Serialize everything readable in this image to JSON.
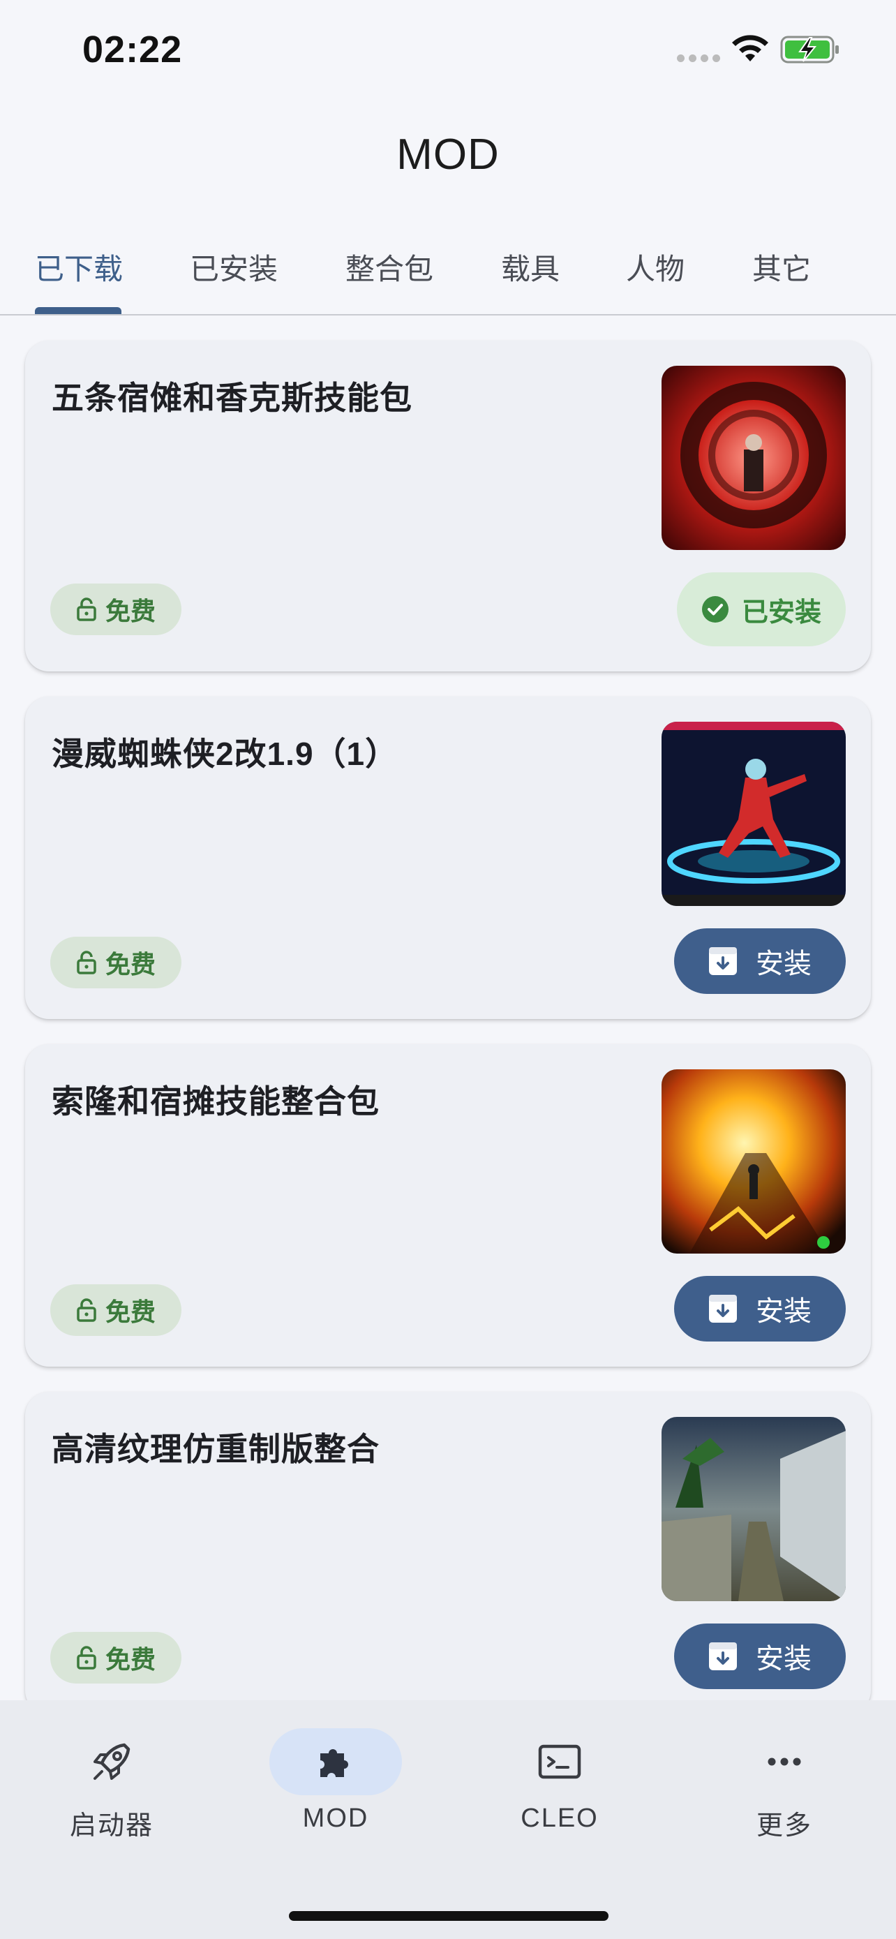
{
  "status_bar": {
    "time": "02:22"
  },
  "header": {
    "title": "MOD"
  },
  "tabs": [
    {
      "label": "已下载",
      "active": true
    },
    {
      "label": "已安装",
      "active": false
    },
    {
      "label": "整合包",
      "active": false
    },
    {
      "label": "载具",
      "active": false
    },
    {
      "label": "人物",
      "active": false
    },
    {
      "label": "其它",
      "active": false
    }
  ],
  "mods": [
    {
      "title": "五条宿傩和香克斯技能包",
      "price_label": "免费",
      "action_label": "已安装",
      "installed": true,
      "thumbnail": "red-ring-scene"
    },
    {
      "title": "漫威蜘蛛侠2改1.9（1）",
      "price_label": "免费",
      "action_label": "安装",
      "installed": false,
      "thumbnail": "spiderman-scene"
    },
    {
      "title": "索隆和宿摊技能整合包",
      "price_label": "免费",
      "action_label": "安装",
      "installed": false,
      "thumbnail": "fire-scene"
    },
    {
      "title": "高清纹理仿重制版整合",
      "price_label": "免费",
      "action_label": "安装",
      "installed": false,
      "thumbnail": "street-scene"
    }
  ],
  "bottom_nav": [
    {
      "label": "启动器",
      "icon": "rocket-icon",
      "active": false
    },
    {
      "label": "MOD",
      "icon": "puzzle-icon",
      "active": true
    },
    {
      "label": "CLEO",
      "icon": "terminal-icon",
      "active": false
    },
    {
      "label": "更多",
      "icon": "more-icon",
      "active": false
    }
  ],
  "colors": {
    "accent": "#3e5f8a",
    "free_badge_bg": "#d9e5d8",
    "installed_bg": "#d8ecd8",
    "install_btn": "#3f5f8c"
  }
}
